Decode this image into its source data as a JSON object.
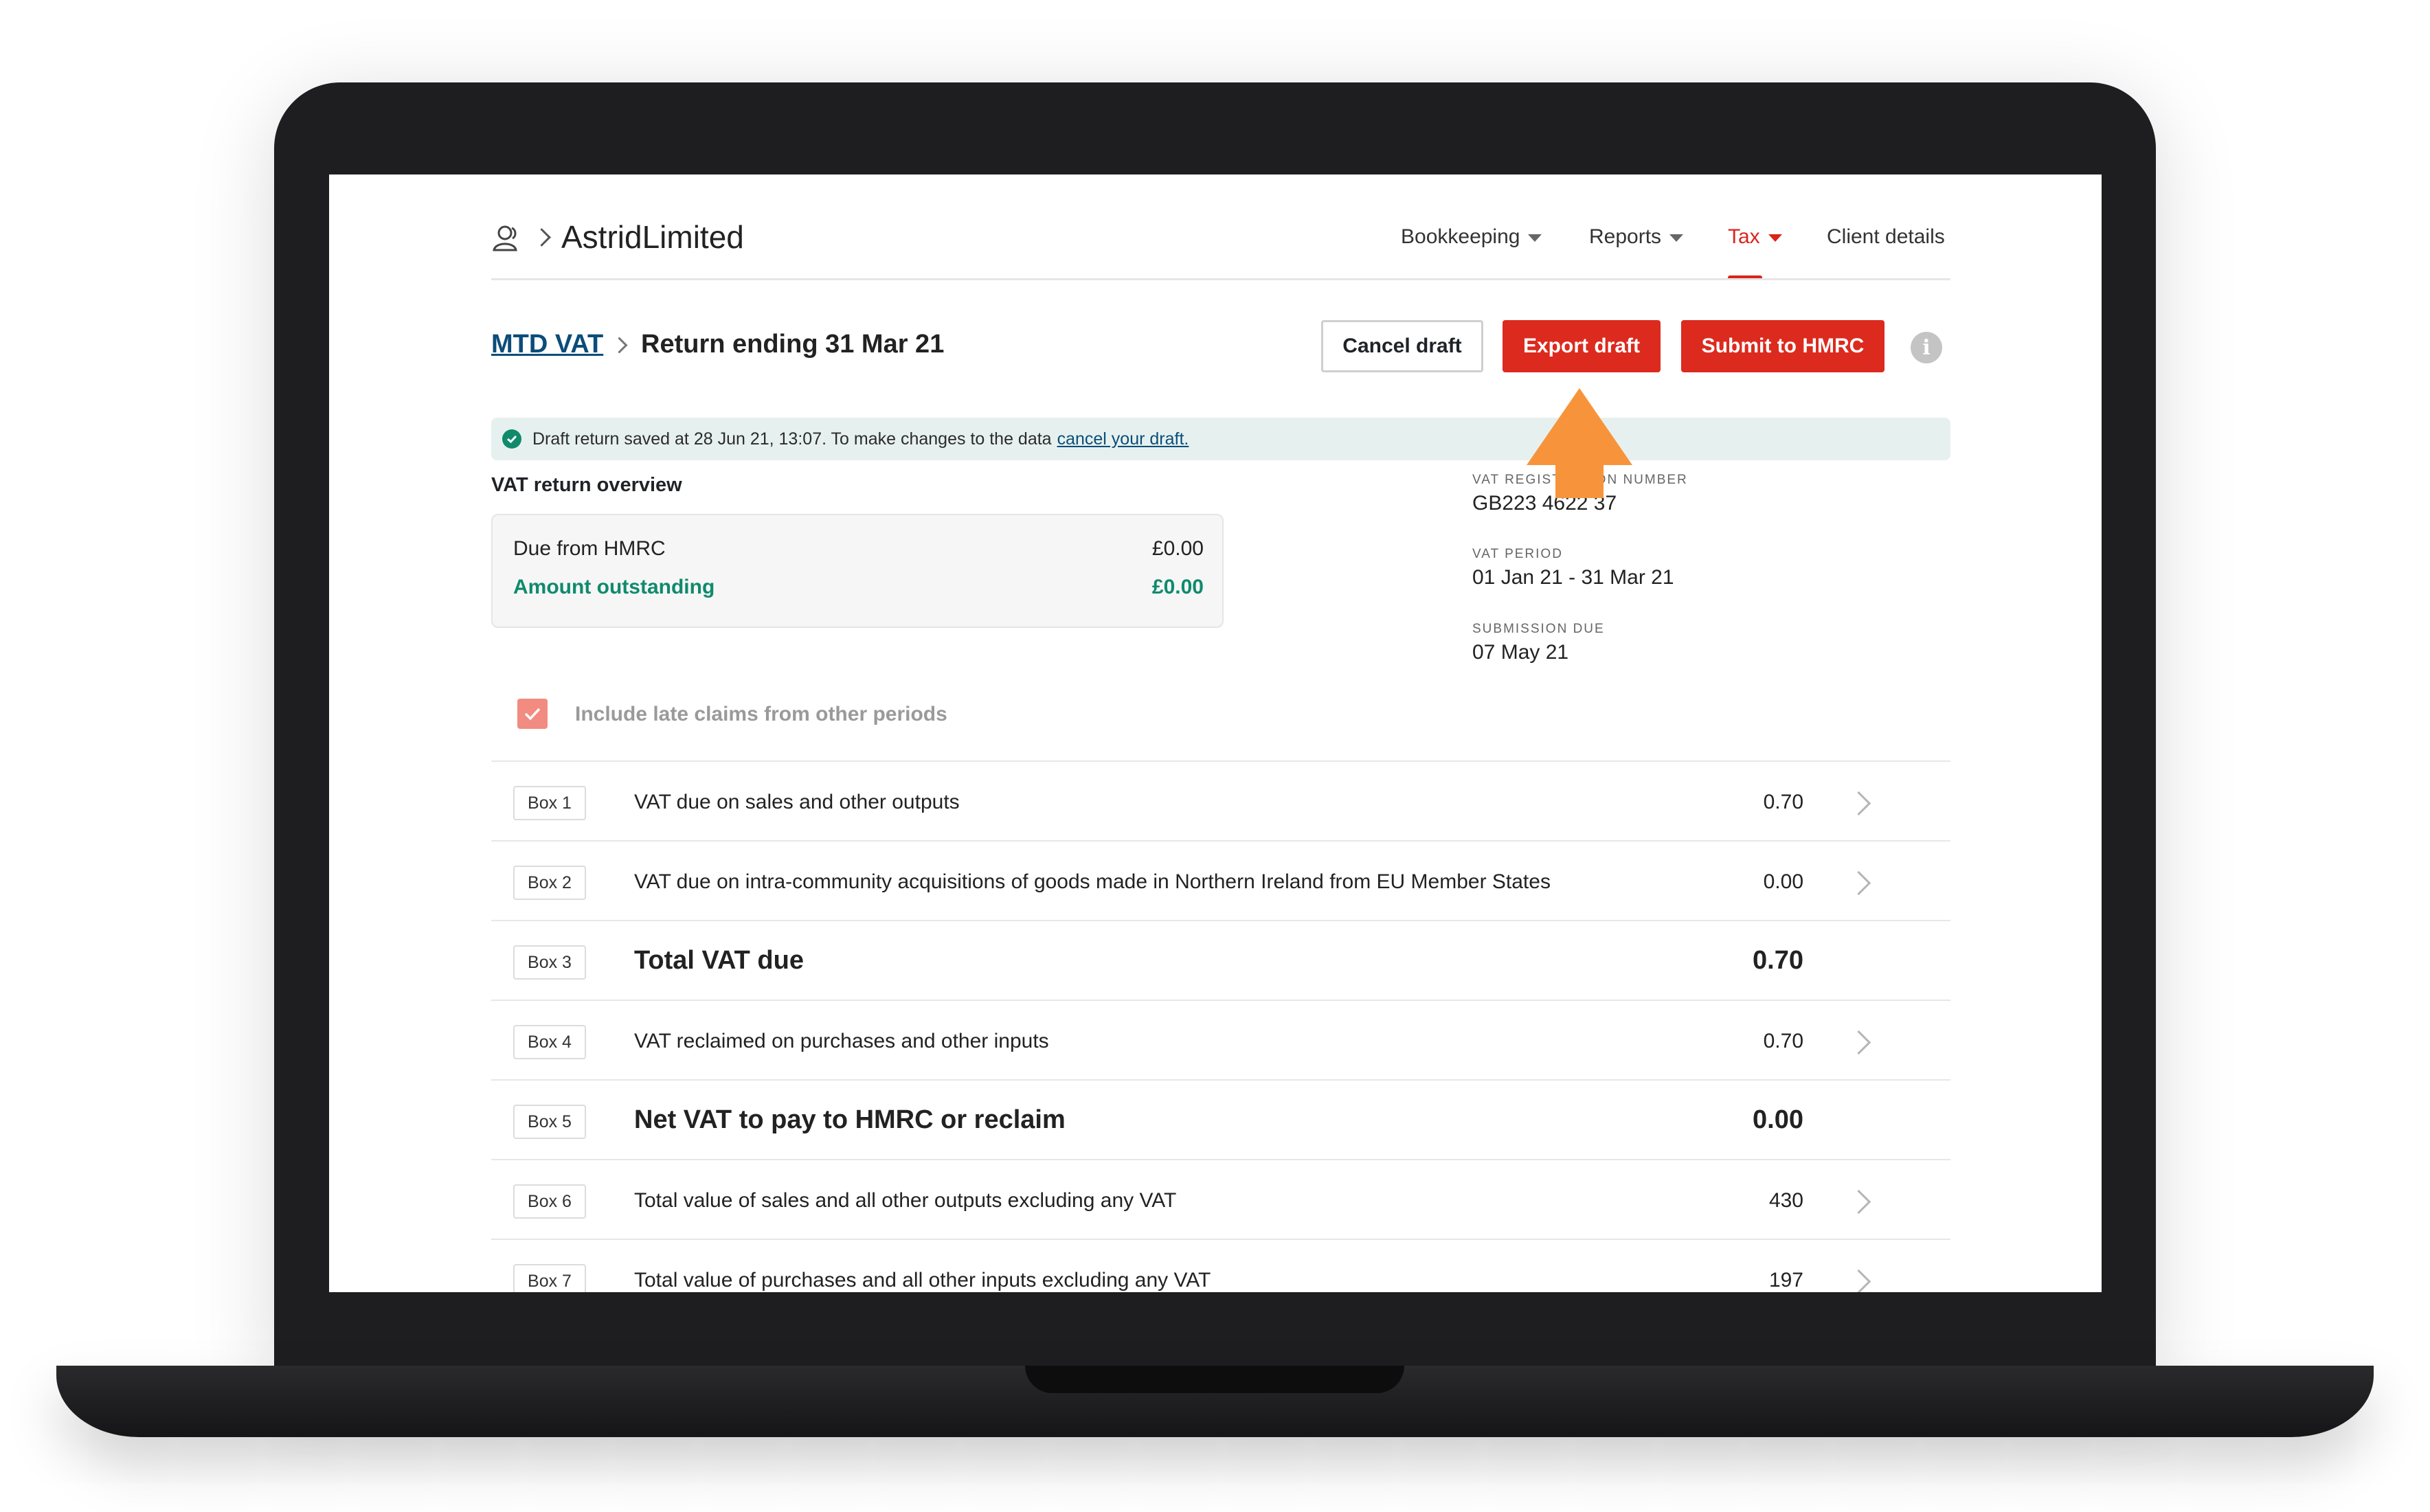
{
  "header": {
    "company_name": "AstridLimited",
    "nav": {
      "bookkeeping": "Bookkeeping",
      "reports": "Reports",
      "tax": "Tax",
      "client_details": "Client details"
    }
  },
  "breadcrumb": {
    "root": "MTD VAT",
    "current": "Return ending 31 Mar 21"
  },
  "actions": {
    "cancel": "Cancel draft",
    "export": "Export draft",
    "submit": "Submit to HMRC",
    "info": "i"
  },
  "banner": {
    "text": "Draft return saved at 28 Jun 21, 13:07. To make changes to the data",
    "link": "cancel your draft."
  },
  "overview": {
    "title": "VAT return overview",
    "due_label": "Due from HMRC",
    "due_value": "£0.00",
    "outstanding_label": "Amount outstanding",
    "outstanding_value": "£0.00"
  },
  "meta": {
    "reg_label": "VAT REGISTRATION NUMBER",
    "reg_value": "GB223 4622 37",
    "period_label": "VAT PERIOD",
    "period_value": "01 Jan 21 - 31 Mar 21",
    "due_label": "SUBMISSION DUE",
    "due_value": "07 May 21"
  },
  "late_claims": {
    "label": "Include late claims from other periods",
    "checked": true
  },
  "boxes": [
    {
      "tag": "Box 1",
      "desc": "VAT due on sales and other outputs",
      "value": "0.70"
    },
    {
      "tag": "Box 2",
      "desc": "VAT due on intra-community acquisitions of goods made in Northern Ireland from EU Member States",
      "value": "0.00"
    },
    {
      "tag": "Box 3",
      "desc": "Total VAT due",
      "value": "0.70"
    },
    {
      "tag": "Box 4",
      "desc": "VAT reclaimed on purchases and other inputs",
      "value": "0.70"
    },
    {
      "tag": "Box 5",
      "desc": "Net VAT to pay to HMRC or reclaim",
      "value": "0.00"
    },
    {
      "tag": "Box 6",
      "desc": "Total value of sales and all other outputs excluding any VAT",
      "value": "430"
    },
    {
      "tag": "Box 7",
      "desc": "Total value of purchases and all other inputs excluding any VAT",
      "value": "197"
    }
  ],
  "colors": {
    "brand_red": "#dc2a1e",
    "accent_green": "#0f8a6d",
    "arrow_orange": "#f7943b"
  }
}
